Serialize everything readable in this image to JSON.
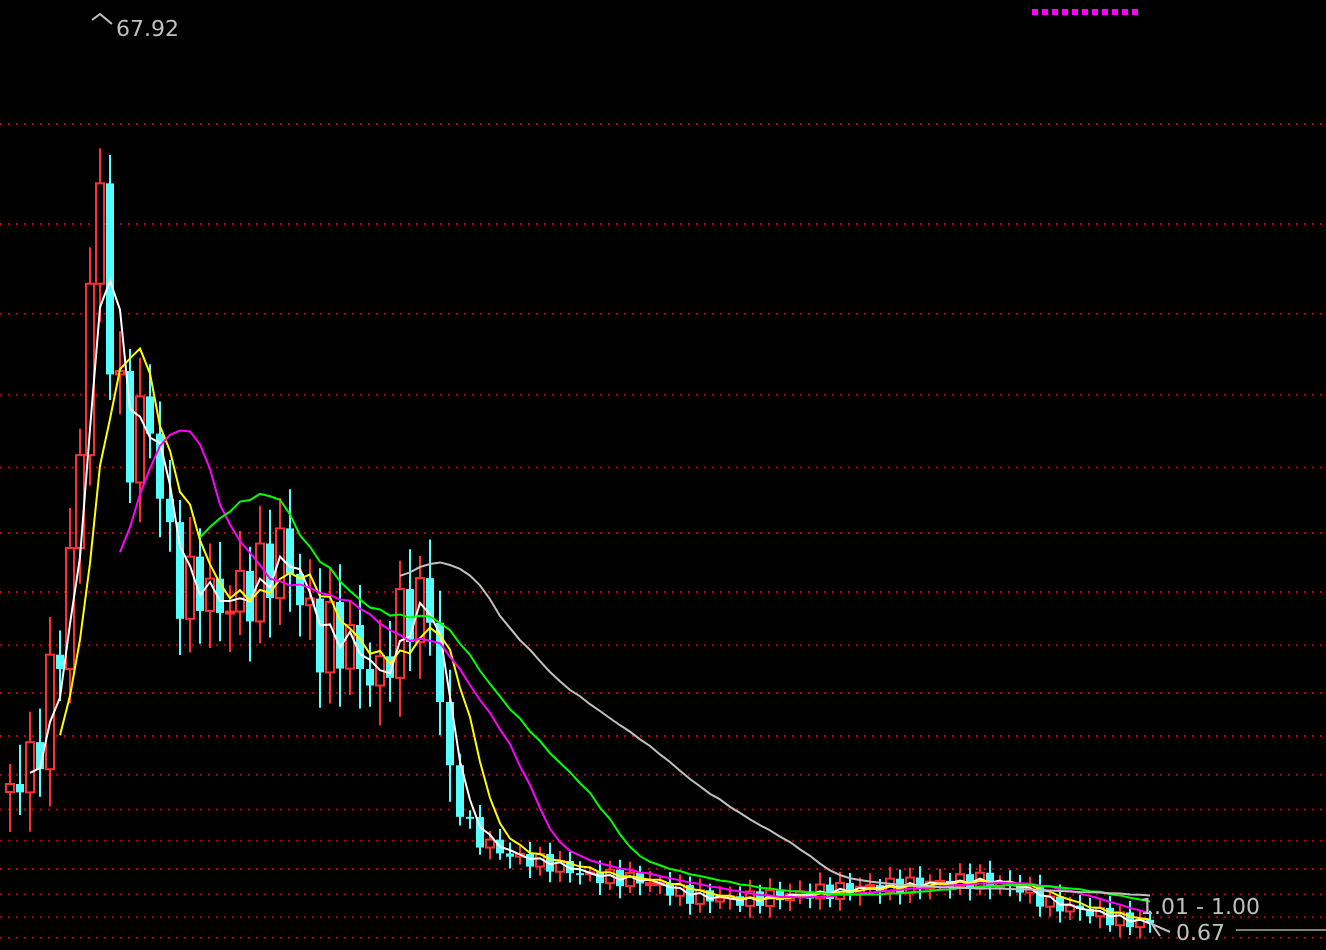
{
  "chart": {
    "high_label": "67.92",
    "range_label": "1.01 - 1.00",
    "low_label": "0.67"
  }
}
